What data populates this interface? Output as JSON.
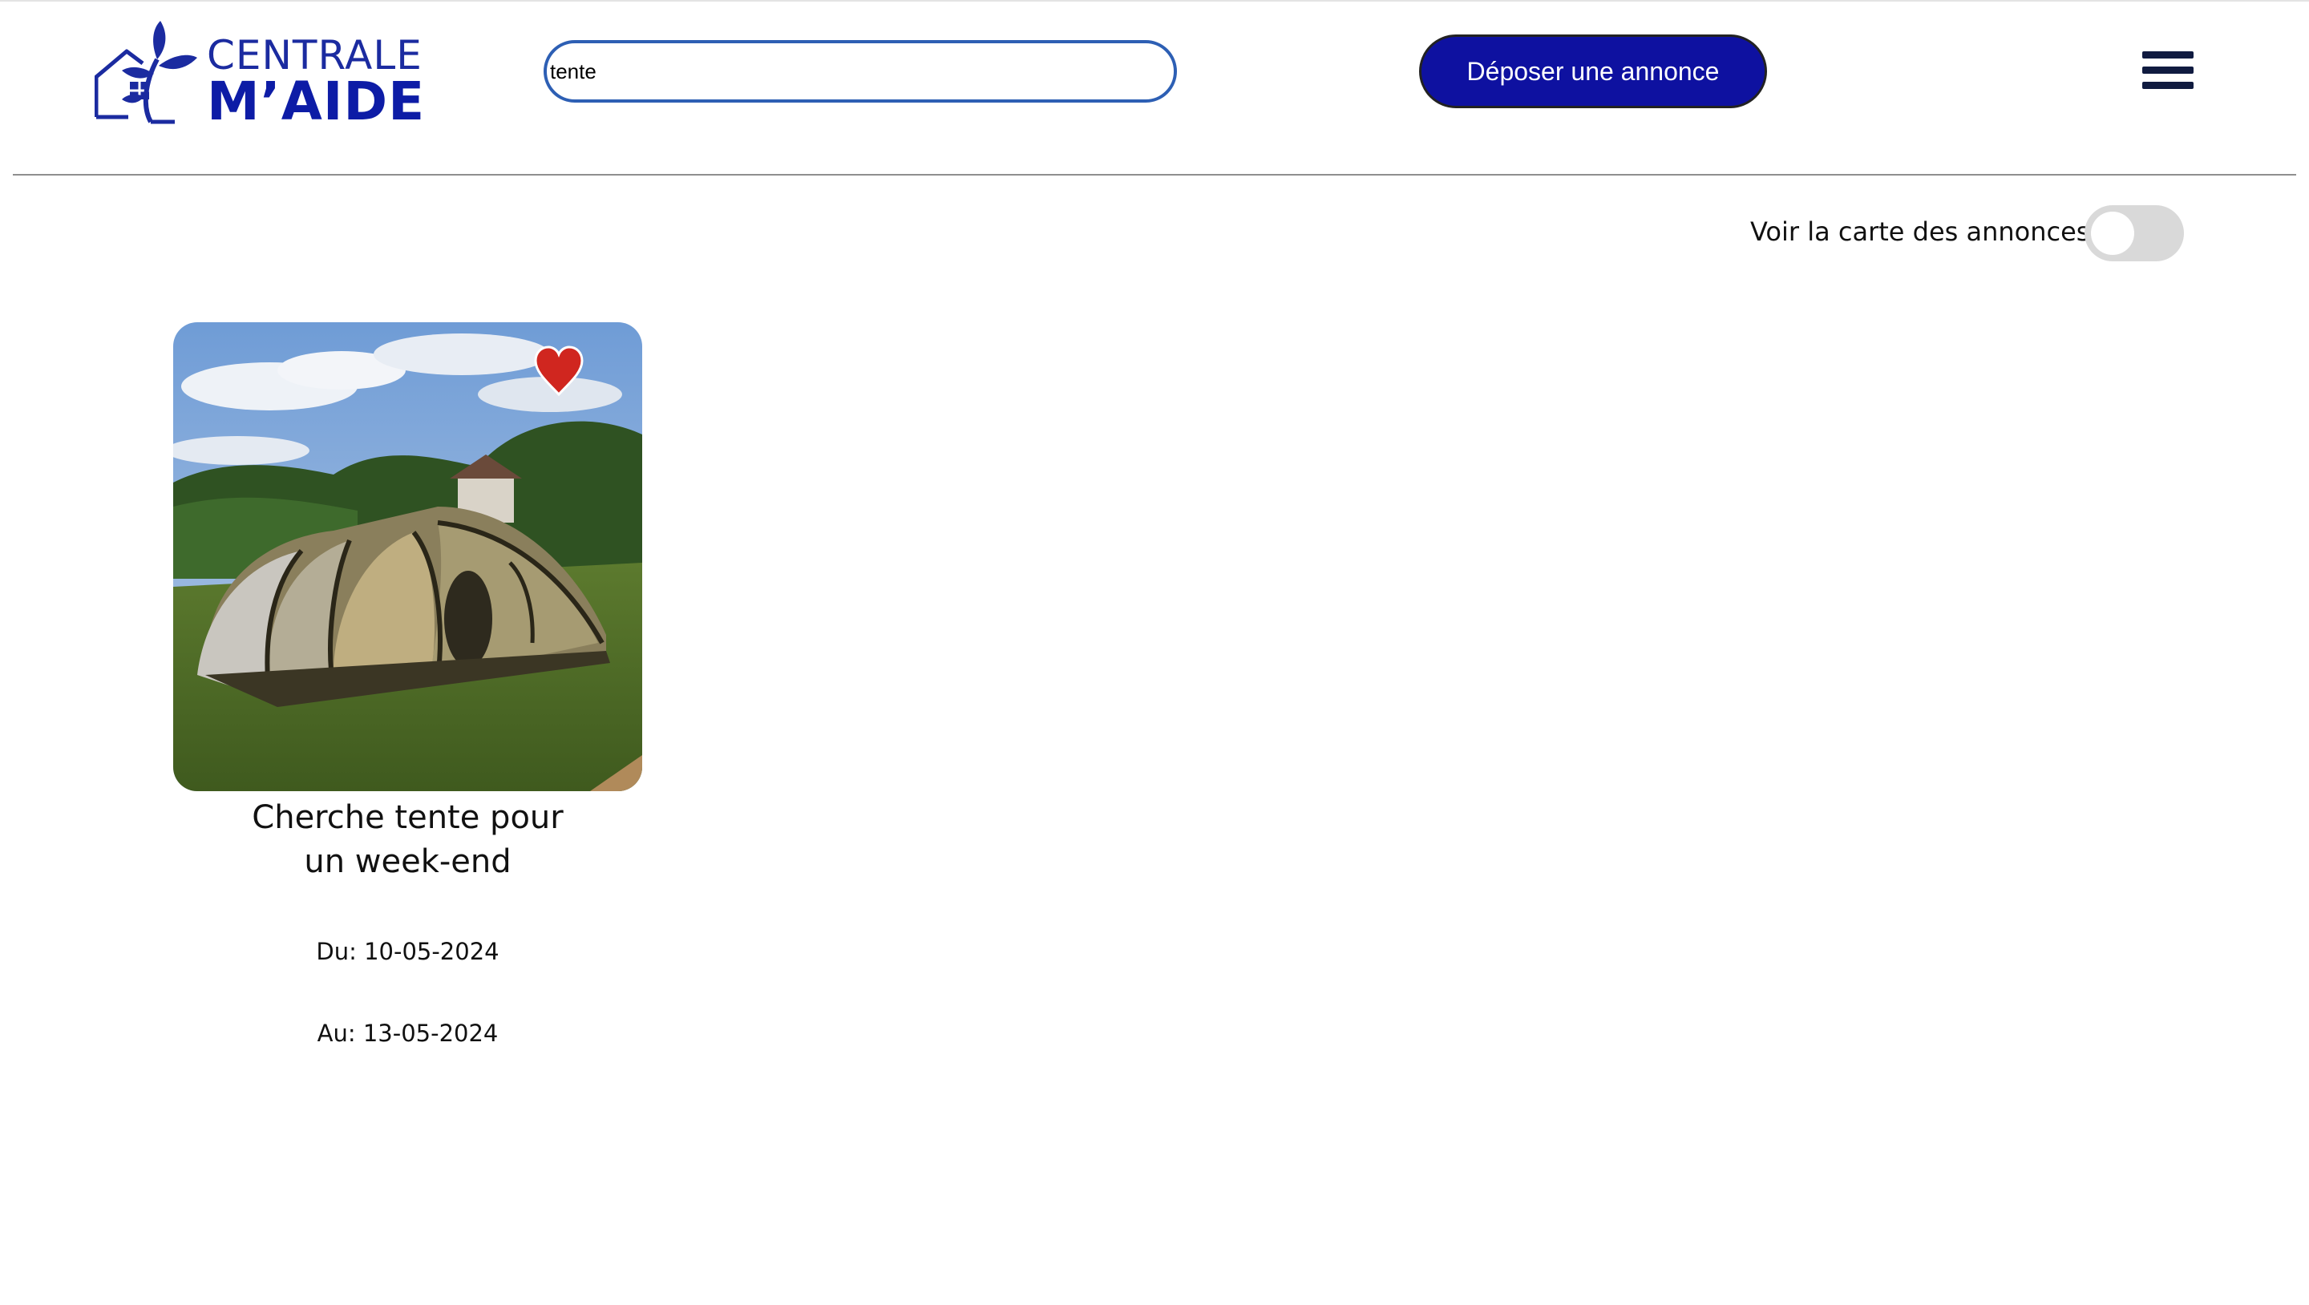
{
  "header": {
    "logo": {
      "line1": "CENTRALE",
      "line2": "M’AIDE"
    },
    "search": {
      "value": "tente",
      "placeholder": ""
    },
    "post_button_label": "Déposer une annonce",
    "menu_icon": "hamburger-menu-icon"
  },
  "map_toggle": {
    "label": "Voir la carte des annonces",
    "enabled": false
  },
  "listings": [
    {
      "title_line1": "Cherche tente pour",
      "title_line2": "un week-end",
      "date_from": "Du: 10-05-2024",
      "date_to": "Au: 13-05-2024",
      "favorite_icon": "heart-icon",
      "favorited": true
    }
  ],
  "colors": {
    "brand_blue": "#0e11a0",
    "search_border": "#2d5fb4",
    "heart_red": "#d0261f",
    "toggle_off": "#d9d9d9"
  }
}
